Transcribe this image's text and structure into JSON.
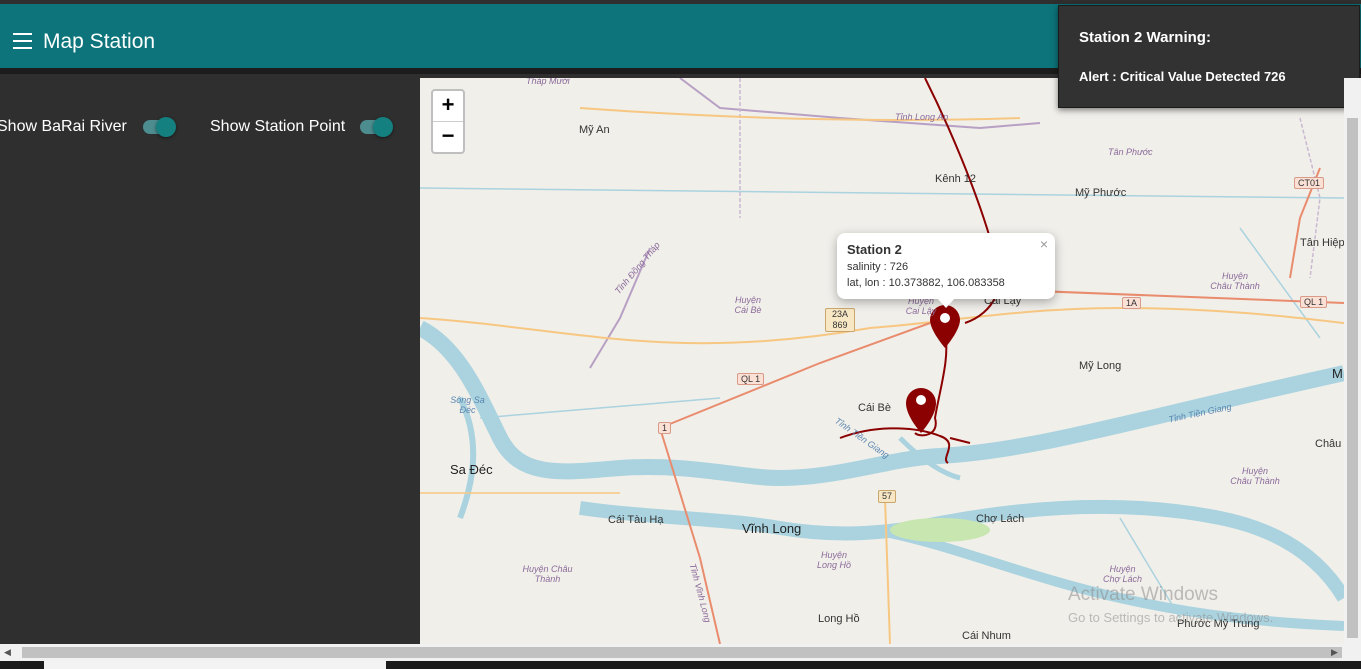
{
  "header": {
    "title": "Map Station",
    "menu_icon": "hamburger-menu-icon"
  },
  "sidebar": {
    "toggles": [
      {
        "label": "Show BaRai River",
        "on": true
      },
      {
        "label": "Show Station Point",
        "on": true
      }
    ]
  },
  "map": {
    "zoom_in": "+",
    "zoom_out": "−",
    "popup": {
      "title": "Station 2",
      "salinity": "salinity : 726",
      "latlon": "lat, lon : 10.373882, 106.083358",
      "close": "×"
    },
    "markers": [
      "Station 2",
      "Station 1"
    ],
    "labels": {
      "thap_muoi": "Tháp Mười",
      "my_an": "Mỹ An",
      "tinh_long_an": "Tỉnh Long An",
      "kenh_12": "Kênh 12",
      "my_phuoc": "Mỹ Phước",
      "tan_phuoc": "Tân Phước",
      "tan_hiep": "Tân Hiệp",
      "huyen_chau_thanh_1": "Huyện Châu Thành",
      "tinh_dong_thap": "Tỉnh Đồng Tháp",
      "huyen_cai_be": "Huyện Cái Bè",
      "huyen_cai_lay": "Huyện Cai Lậy",
      "cai_lay": "Cai Lậy",
      "my_long": "Mỹ Long",
      "cai_be": "Cái Bè",
      "tinh_tien_giang_1": "Tỉnh Tiền Giang",
      "tinh_tien_giang_2": "Tỉnh Tiền Giang",
      "chau": "Châu",
      "huyen_chau_thanh_2": "Huyện Châu Thành",
      "song_sa_dec": "Sông Sa Đéc",
      "sa_dec": "Sa Đéc",
      "cai_tau_ha": "Cái Tàu Hạ",
      "vinh_long": "Vĩnh Long",
      "huyen_long_ho": "Huyện Long Hồ",
      "cho_lach": "Chợ Lách",
      "huyen_chau_thanh_3": "Huyện Châu Thành",
      "huyen_cho_lach": "Huyện Chợ Lách",
      "tinh_vinh_long": "Tỉnh Vĩnh Long",
      "long_ho": "Long Hồ",
      "cai_nhum": "Cái Nhum",
      "phuoc_my_trung": "Phước Mỹ Trung",
      "m_edge": "M"
    },
    "shields": {
      "ct01": "CT01",
      "a1": "1A",
      "ql1_right": "QL 1",
      "r23a": "23A 869",
      "ql1_left": "QL 1",
      "r1": "1",
      "r57": "57"
    }
  },
  "alert": {
    "title": "Station 2 Warning:",
    "message": "Alert : Critical Value Detected 726"
  },
  "watermark": {
    "line1": "Activate Windows",
    "line2": "Go to Settings to activate Windows."
  }
}
